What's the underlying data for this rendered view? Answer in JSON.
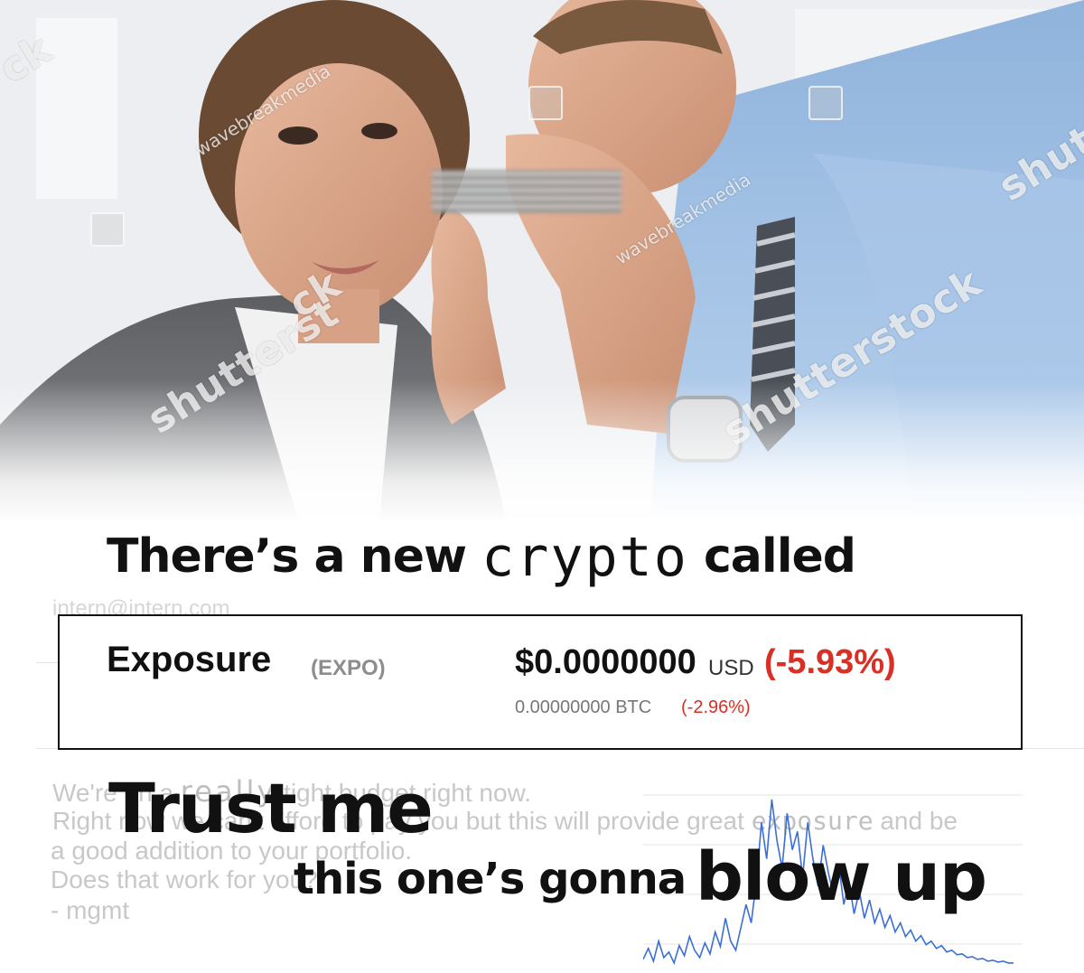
{
  "photo": {
    "watermarks": [
      "shutterstock",
      "wavebreakmedia",
      "shutterst",
      "ck",
      "shutt"
    ]
  },
  "headline": {
    "prefix": "There’s a new",
    "mono_word": "crypto",
    "suffix": "called"
  },
  "email": {
    "header": "intern@intern.com",
    "line1_a": "We're on a",
    "line1_really": "really",
    "line1_b": "tight budget right now.",
    "line2": "Right now we can't afford to pay you but this will provide great",
    "line2_exposure": "exposure",
    "line2_end": "and be",
    "line3": "a good addition to your portfolio.",
    "line4": "Does that work for you?",
    "line5": "- mgmt"
  },
  "ticker": {
    "name": "Exposure",
    "symbol": "(EXPO)",
    "price_usd": "$0.0000000",
    "unit": "USD",
    "change_usd": "(-5.93%)",
    "price_btc": "0.00000000 BTC",
    "change_btc": "(-2.96%)",
    "negative_color": "#d93025"
  },
  "captions": {
    "trust": "Trust me",
    "gonna": "this one’s gonna",
    "blowup": "blow up"
  },
  "chart_data": {
    "type": "line",
    "title": "",
    "xlabel": "",
    "ylabel": "",
    "grid": true,
    "series": [
      {
        "color": "#3b6fd6",
        "values": [
          10,
          22,
          8,
          30,
          12,
          18,
          6,
          25,
          14,
          35,
          20,
          12,
          28,
          16,
          40,
          24,
          55,
          30,
          20,
          45,
          70,
          50,
          95,
          160,
          120,
          185,
          140,
          110,
          170,
          130,
          150,
          100,
          160,
          120,
          90,
          135,
          105,
          80,
          115,
          70,
          95,
          60,
          85,
          55,
          75,
          50,
          65,
          45,
          58,
          40,
          50,
          35,
          42,
          30,
          36,
          26,
          30,
          22,
          25,
          18,
          20,
          15,
          16,
          12,
          13,
          10,
          11,
          8,
          9,
          7,
          8,
          6,
          6
        ]
      }
    ]
  }
}
